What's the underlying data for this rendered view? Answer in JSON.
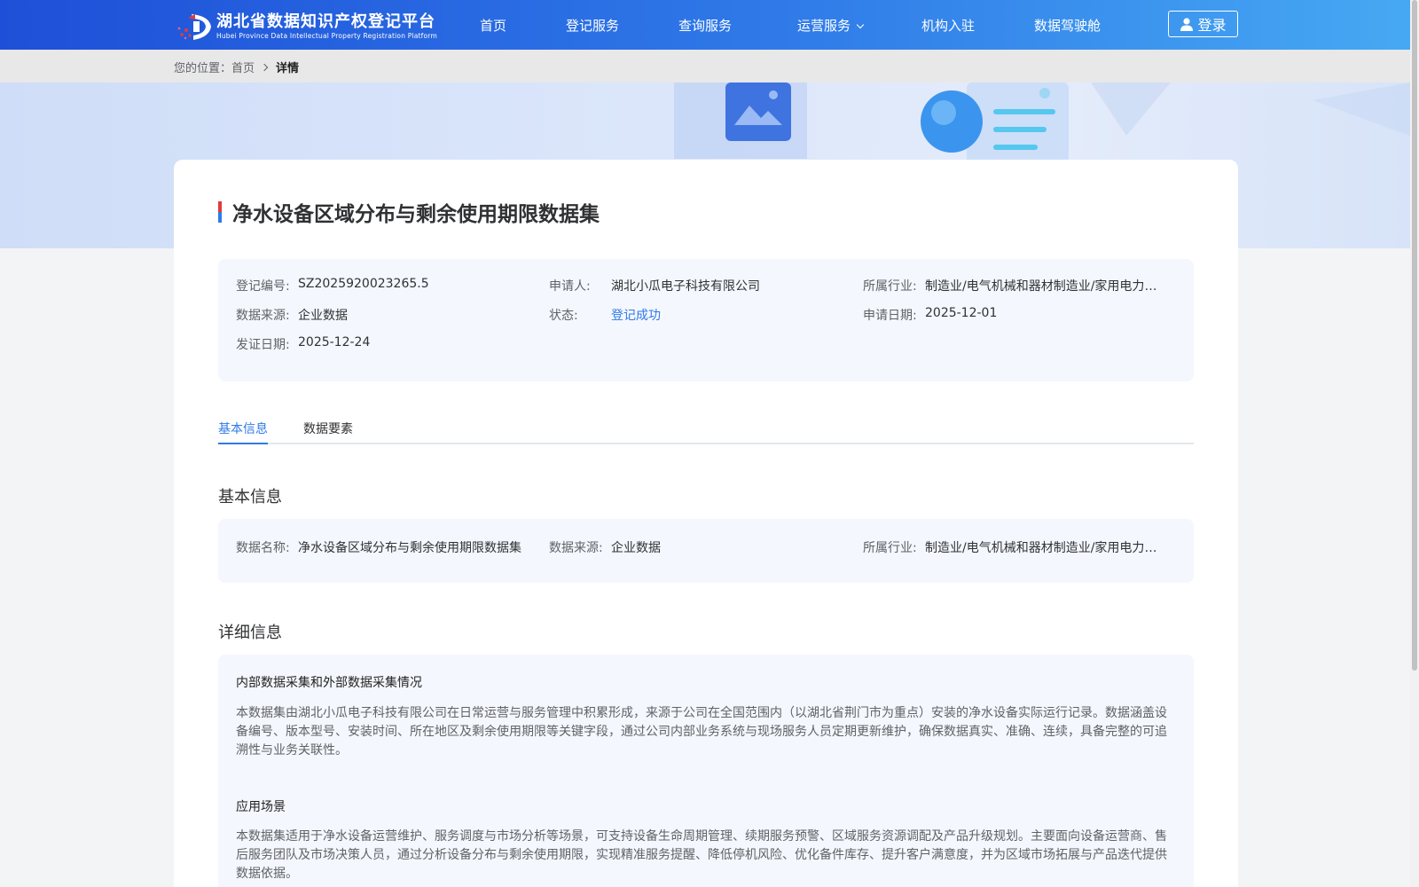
{
  "header": {
    "logo_cn": "湖北省数据知识产权登记平台",
    "logo_en": "Hubei Province Data Intellectual Property Registration Platform",
    "nav": [
      "首页",
      "登记服务",
      "查询服务",
      "运营服务",
      "机构入驻",
      "数据驾驶舱"
    ],
    "login_label": "登录",
    "colors": {
      "header_start": "#1e4fd8",
      "header_end": "#47a9f3"
    }
  },
  "breadcrumb": {
    "prefix": "您的位置：",
    "home": "首页",
    "current": "详情"
  },
  "detail": {
    "title": "净水设备区域分布与剩余使用期限数据集",
    "summary": {
      "reg_no_label": "登记编号:",
      "reg_no": "SZ2025920023265.5",
      "applicant_label": "申请人:",
      "applicant": "湖北小瓜电子科技有限公司",
      "industry_label": "所属行业:",
      "industry": "制造业/电气机械和器材制造业/家用电力器具制造",
      "source_label": "数据来源:",
      "source": "企业数据",
      "status_label": "状态:",
      "status": "登记成功",
      "apply_date_label": "申请日期:",
      "apply_date": "2025-12-01",
      "issue_date_label": "发证日期:",
      "issue_date": "2025-12-24"
    },
    "tabs": [
      "基本信息",
      "数据要素"
    ],
    "basic": {
      "section_title": "基本信息",
      "name_label": "数据名称:",
      "name": "净水设备区域分布与剩余使用期限数据集",
      "source_label": "数据来源:",
      "source": "企业数据",
      "industry_label": "所属行业:",
      "industry": "制造业/电气机械和器材制造业/家用电力器具制造"
    },
    "details": {
      "section_title": "详细信息",
      "collection_title": "内部数据采集和外部数据采集情况",
      "collection_text": "本数据集由湖北小瓜电子科技有限公司在日常运营与服务管理中积累形成，来源于公司在全国范围内（以湖北省荆门市为重点）安装的净水设备实际运行记录。数据涵盖设备编号、版本型号、安装时间、所在地区及剩余使用期限等关键字段，通过公司内部业务系统与现场服务人员定期更新维护，确保数据真实、准确、连续，具备完整的可追溯性与业务关联性。",
      "scenario_title": "应用场景",
      "scenario_text": "本数据集适用于净水设备运营维护、服务调度与市场分析等场景，可支持设备生命周期管理、续期服务预警、区域服务资源调配及产品升级规划。主要面向设备运营商、售后服务团队及市场决策人员，通过分析设备分布与剩余使用期限，实现精准服务提醒、降低停机风险、优化备件库存、提升客户满意度，并为区域市场拓展与产品迭代提供数据依据。"
    }
  },
  "accent": "#2f7ae8"
}
